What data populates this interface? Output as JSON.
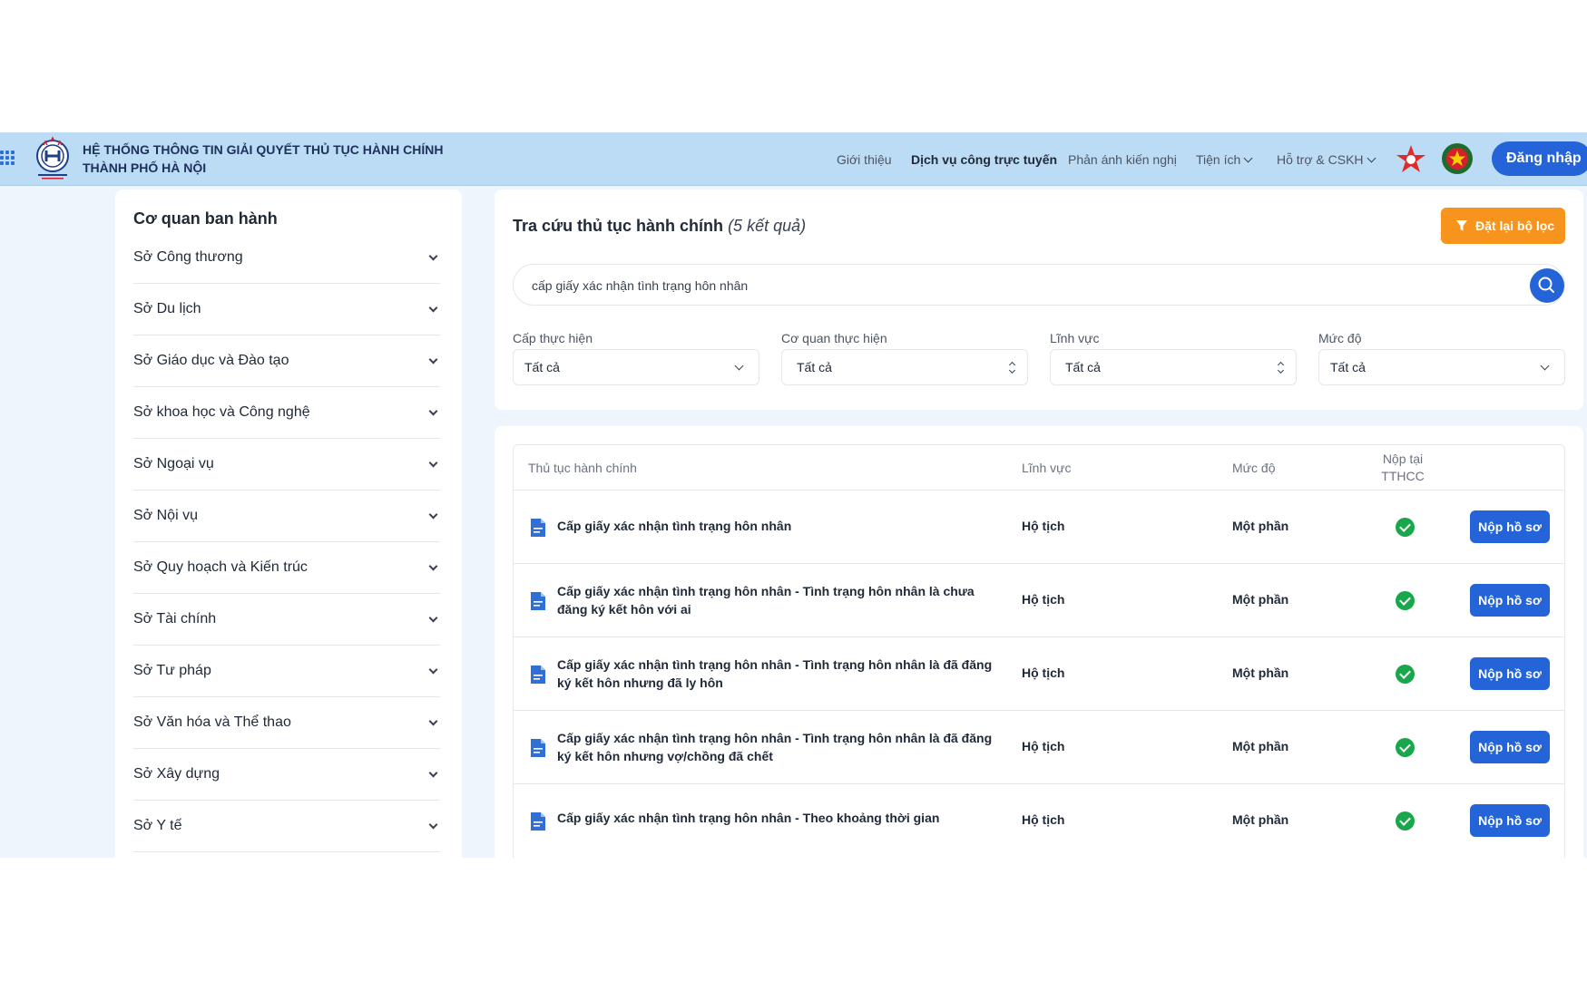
{
  "header": {
    "brand_line1": "HỆ THỐNG THÔNG TIN GIẢI QUYẾT THỦ TỤC HÀNH CHÍNH",
    "brand_line2": "THÀNH PHỐ HÀ NỘI",
    "nav": [
      {
        "label": "Giới thiệu"
      },
      {
        "label": "Dịch vụ công trực tuyến"
      },
      {
        "label": "Phản ánh kiến nghị"
      },
      {
        "label": "Tiện ích"
      },
      {
        "label": "Hỗ trợ & CSKH"
      }
    ],
    "login_label": "Đăng nhập",
    "accent": "#2563d9",
    "bar_color": "#bcdcf5"
  },
  "sidebar": {
    "title": "Cơ quan ban hành",
    "items": [
      {
        "label": "Sở Công thương"
      },
      {
        "label": "Sở Du lịch"
      },
      {
        "label": "Sở Giáo dục và Đào tạo"
      },
      {
        "label": "Sở khoa học và Công nghệ"
      },
      {
        "label": "Sở Ngoại vụ"
      },
      {
        "label": "Sở Nội vụ"
      },
      {
        "label": "Sở Quy hoạch và Kiến trúc"
      },
      {
        "label": "Sở Tài chính"
      },
      {
        "label": "Sở Tư pháp"
      },
      {
        "label": "Sở Văn hóa và Thể thao"
      },
      {
        "label": "Sở Xây dựng"
      },
      {
        "label": "Sở Y tế"
      }
    ]
  },
  "search": {
    "title": "Tra cứu thủ tục hành chính",
    "result_count": "(5 kết quả)",
    "reset_label": "Đặt lại bộ lọc",
    "reset_color": "#f7941d",
    "query": "cấp giấy xác nhận tình trạng hôn nhân",
    "filters": [
      {
        "label": "Cấp thực hiện",
        "value": "Tất cả"
      },
      {
        "label": "Cơ quan thực hiện",
        "value": "Tất cả"
      },
      {
        "label": "Lĩnh vực",
        "value": "Tất cả"
      },
      {
        "label": "Mức độ",
        "value": "Tất cả"
      }
    ]
  },
  "table": {
    "headers": {
      "name": "Thủ tục hành chính",
      "field": "Lĩnh vực",
      "level": "Mức độ",
      "submit_line1": "Nộp tại",
      "submit_line2": "TTHCC"
    },
    "submit_label": "Nộp hồ sơ",
    "rows": [
      {
        "name": "Cấp giấy xác nhận tình trạng hôn nhân",
        "field": "Hộ tịch",
        "level": "Một phần"
      },
      {
        "name": "Cấp giấy xác nhận tình trạng hôn nhân - Tình trạng hôn nhân là chưa đăng ký kết hôn với ai",
        "field": "Hộ tịch",
        "level": "Một phần"
      },
      {
        "name": "Cấp giấy xác nhận tình trạng hôn nhân - Tình trạng hôn nhân là đã đăng ký kết hôn nhưng đã ly hôn",
        "field": "Hộ tịch",
        "level": "Một phần"
      },
      {
        "name": "Cấp giấy xác nhận tình trạng hôn nhân - Tình trạng hôn nhân là đã đăng ký kết hôn nhưng vợ/chồng đã chết",
        "field": "Hộ tịch",
        "level": "Một phần"
      },
      {
        "name": "Cấp giấy xác nhận tình trạng hôn nhân - Theo khoảng thời gian",
        "field": "Hộ tịch",
        "level": "Một phần"
      }
    ]
  },
  "icons": {
    "apps": "grid-icon",
    "logo": "hanoi-emblem-icon",
    "search": "search-icon",
    "filter": "filter-icon",
    "document": "document-icon",
    "check": "check-circle-icon"
  }
}
